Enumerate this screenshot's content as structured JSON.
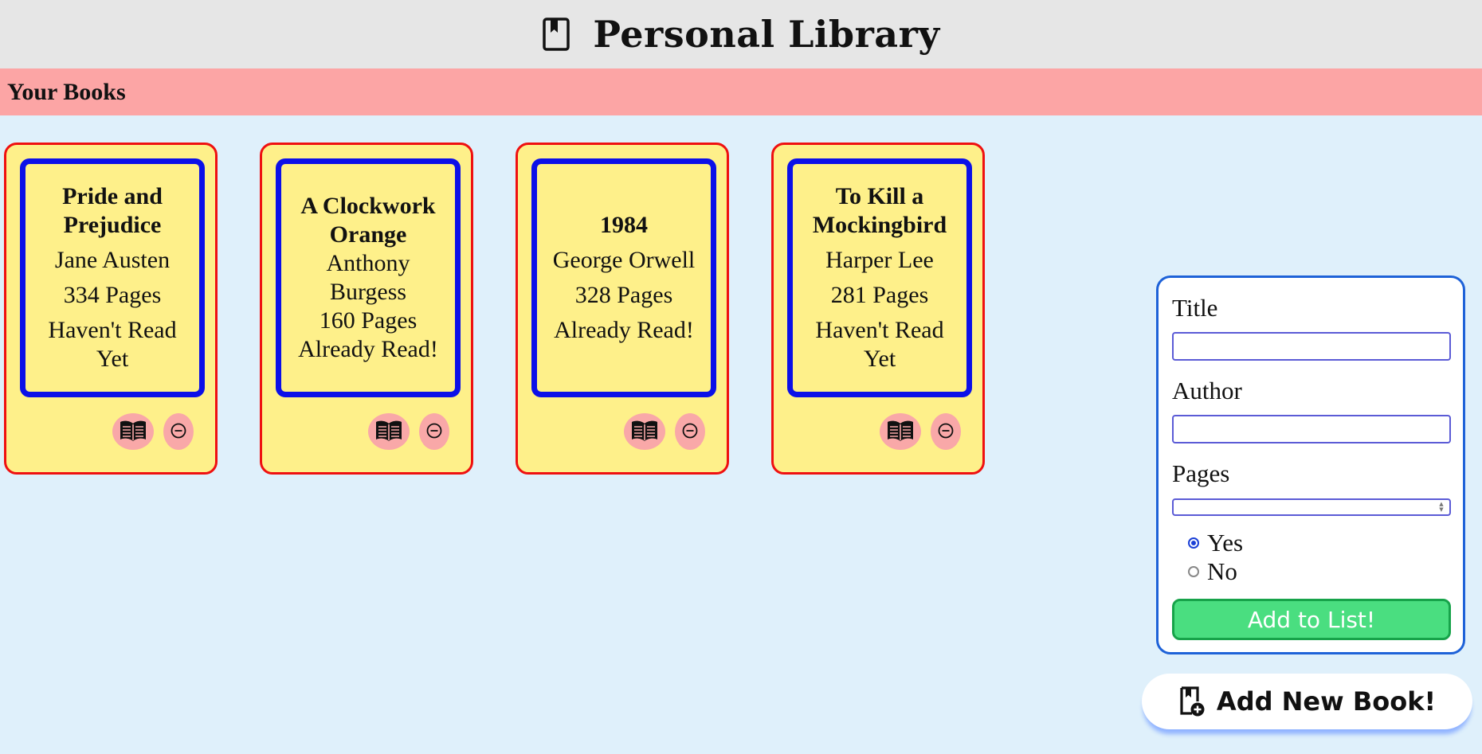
{
  "app": {
    "title": "Personal Library",
    "logo_icon": "bookmark-book-icon"
  },
  "section": {
    "title": "Your Books"
  },
  "books": [
    {
      "title": "Pride and Prejudice",
      "author": "Jane Austen",
      "pages": "334 Pages",
      "status": "Haven't Read Yet"
    },
    {
      "title": "A Clockwork Orange",
      "author": "Anthony Burgess",
      "pages": "160 Pages",
      "status": "Already Read!"
    },
    {
      "title": "1984",
      "author": "George Orwell",
      "pages": "328 Pages",
      "status": "Already Read!"
    },
    {
      "title": "To Kill a Mockingbird",
      "author": "Harper Lee",
      "pages": "281 Pages",
      "status": "Haven't Read Yet"
    }
  ],
  "card_actions": {
    "read_icon": "open-book-icon",
    "remove_icon": "minus-circle-icon"
  },
  "form": {
    "title_label": "Title",
    "title_value": "",
    "author_label": "Author",
    "author_value": "",
    "pages_label": "Pages",
    "pages_value": "",
    "read_options": [
      {
        "label": "Yes",
        "checked": true
      },
      {
        "label": "No",
        "checked": false
      }
    ],
    "submit_label": "Add to List!"
  },
  "add_book_button": {
    "label": "Add New Book!",
    "icon": "add-book-icon"
  },
  "colors": {
    "header_bg": "#e6e6e6",
    "section_bg": "#fca5a5",
    "page_bg": "#dff0fb",
    "card_bg": "#fef08a",
    "card_border": "#ef1010",
    "card_inner_border": "#0c10e8",
    "action_button_bg": "#f9a8a8",
    "form_border": "#1e62d8",
    "submit_bg": "#4ade80"
  }
}
